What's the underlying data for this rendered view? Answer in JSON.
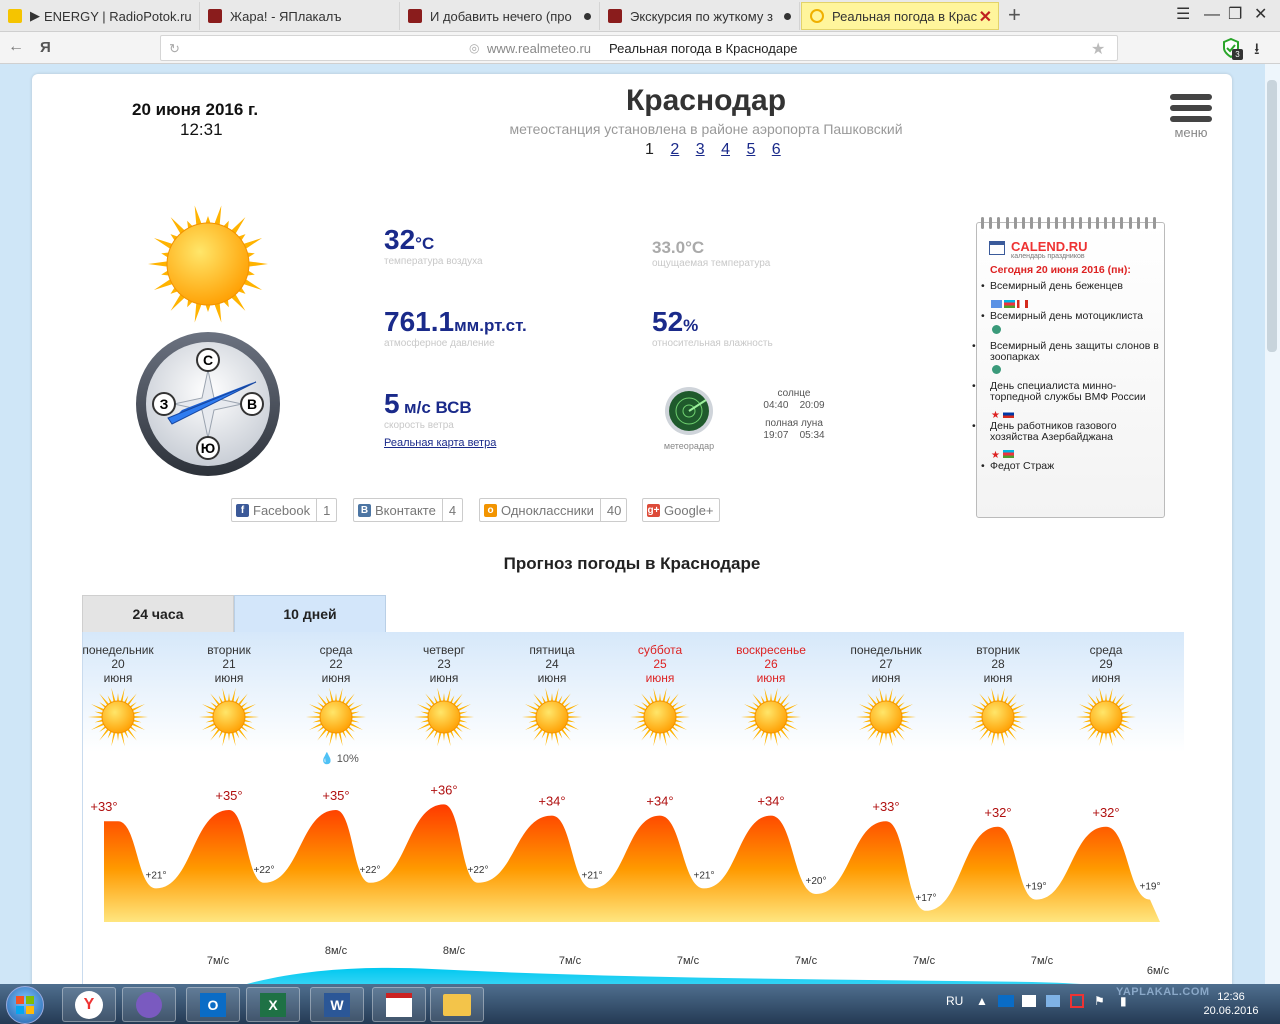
{
  "browser": {
    "tabs": [
      {
        "label": "ENERGY | RadioPotok.ru"
      },
      {
        "label": "Жара! - ЯПлакалъ"
      },
      {
        "label": "И добавить нечего (про"
      },
      {
        "label": "Экскурсия по жуткому з"
      },
      {
        "label": "Реальная погода в Крас"
      }
    ],
    "new_tab": "+",
    "url_host": "www.realmeteo.ru",
    "url_title": "Реальная погода в Краснодаре",
    "yandex_letter": "Я",
    "badge_count": "3"
  },
  "header": {
    "date": "20 июня 2016 г.",
    "time": "12:31",
    "city": "Краснодар",
    "subtitle": "метеостанция установлена в районе аэропорта Пашковский",
    "pages": [
      "1",
      "2",
      "3",
      "4",
      "5",
      "6"
    ],
    "menu_label": "меню"
  },
  "weather": {
    "temp_value": "32",
    "temp_unit": "°C",
    "temp_label": "температура воздуха",
    "feels_value": "33.0°C",
    "feels_label": "ощущаемая температура",
    "pressure_value": "761.1",
    "pressure_unit": "мм.рт.ст.",
    "pressure_label": "атмосферное давление",
    "humidity_value": "52",
    "humidity_unit": "%",
    "humidity_label": "относительная влажность",
    "wind_value": "5",
    "wind_unit": "м/с ВСВ",
    "wind_label": "скорость ветра",
    "wind_map_link": "Реальная карта ветра",
    "radar_label": "метеорадар",
    "sun_label": "солнце",
    "sunrise": "04:40",
    "sunset": "20:09",
    "moon_label": "полная луна",
    "moonrise": "19:07",
    "moonset": "05:34",
    "compass": {
      "n": "С",
      "s": "Ю",
      "w": "З",
      "e": "В"
    }
  },
  "share": [
    {
      "label": "Facebook",
      "count": "1",
      "icon": "f",
      "color": "#3b5998"
    },
    {
      "label": "Вконтакте",
      "count": "4",
      "icon": "В",
      "color": "#4c75a3"
    },
    {
      "label": "Одноклассники",
      "count": "40",
      "icon": "о",
      "color": "#f29400"
    },
    {
      "label": "Google+",
      "count": "",
      "icon": "g+",
      "color": "#dd4b39"
    }
  ],
  "calendar": {
    "brand": "CALEND.RU",
    "brand_sub": "календарь праздников",
    "today": "Сегодня 20 июня 2016 (пн):",
    "items": [
      "Всемирный день беженцев",
      "Всемирный день мотоциклиста",
      "Всемирный день защиты слонов в зоопарках",
      "День специалиста минно-торпедной службы ВМФ России",
      "День работников газового хозяйства Азербайджана",
      "Федот Страж"
    ]
  },
  "forecast": {
    "title": "Прогноз погоды в Краснодаре",
    "tab_24": "24 часа",
    "tab_10": "10 дней",
    "precip_note": "10%",
    "days": [
      {
        "weekday": "понедельник",
        "date": "20",
        "month": "июня",
        "weekend": false
      },
      {
        "weekday": "вторник",
        "date": "21",
        "month": "июня",
        "weekend": false
      },
      {
        "weekday": "среда",
        "date": "22",
        "month": "июня",
        "weekend": false
      },
      {
        "weekday": "четверг",
        "date": "23",
        "month": "июня",
        "weekend": false
      },
      {
        "weekday": "пятница",
        "date": "24",
        "month": "июня",
        "weekend": false
      },
      {
        "weekday": "суббота",
        "date": "25",
        "month": "июня",
        "weekend": true
      },
      {
        "weekday": "воскресенье",
        "date": "26",
        "month": "июня",
        "weekend": true
      },
      {
        "weekday": "понедельник",
        "date": "27",
        "month": "июня",
        "weekend": false
      },
      {
        "weekday": "вторник",
        "date": "28",
        "month": "июня",
        "weekend": false
      },
      {
        "weekday": "среда",
        "date": "29",
        "month": "июня",
        "weekend": false
      }
    ],
    "highs": [
      "+33°",
      "+35°",
      "+35°",
      "+36°",
      "+34°",
      "+34°",
      "+34°",
      "+33°",
      "+32°",
      "+32°"
    ],
    "lows": [
      "+21°",
      "+22°",
      "+22°",
      "+22°",
      "+21°",
      "+21°",
      "+20°",
      "+17°",
      "+19°",
      "+19°"
    ],
    "high_values": [
      33,
      35,
      35,
      36,
      34,
      34,
      34,
      33,
      32,
      32
    ],
    "low_values": [
      21,
      22,
      22,
      22,
      21,
      21,
      20,
      17,
      19,
      19
    ],
    "winds": [
      "7м/с",
      "8м/с",
      "8м/с",
      "7м/с",
      "7м/с",
      "7м/с",
      "7м/с",
      "7м/с",
      "6м/с"
    ]
  },
  "taskbar": {
    "lang": "RU",
    "clock_time": "12:36",
    "clock_date": "20.06.2016",
    "watermark": "YAPLAKAL.COM"
  },
  "colors": {
    "accent_blue": "#1a2a8a",
    "weekend_red": "#dd2222",
    "temp_orange": "#ff8a00",
    "active_tab": "#fff59c"
  }
}
